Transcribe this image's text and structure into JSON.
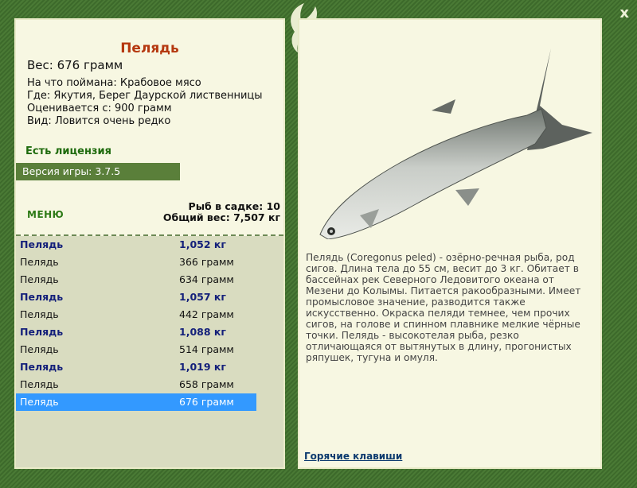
{
  "window": {
    "close_label": "x"
  },
  "catch": {
    "title": "Пелядь",
    "weight": "Вес: 676 грамм",
    "bait": "На что поймана: Крабовое мясо",
    "place": "Где: Якутия, Берег Даурской лиственницы",
    "value": "Оценивается с: 900 грамм",
    "rarity": "Вид: Ловится очень редко"
  },
  "license": "Есть лицензия",
  "version": "Версия игры: 3.7.5",
  "menu_label": "МЕНЮ",
  "cage": {
    "count": "Рыб в садке: 10",
    "total": "Общий вес: 7,507 кг"
  },
  "fish_list": [
    {
      "name": "Пелядь",
      "weight": "1,052 кг",
      "big": true
    },
    {
      "name": "Пелядь",
      "weight": "366 грамм",
      "big": false
    },
    {
      "name": "Пелядь",
      "weight": "634 грамм",
      "big": false
    },
    {
      "name": "Пелядь",
      "weight": "1,057 кг",
      "big": true
    },
    {
      "name": "Пелядь",
      "weight": "442 грамм",
      "big": false
    },
    {
      "name": "Пелядь",
      "weight": "1,088 кг",
      "big": true
    },
    {
      "name": "Пелядь",
      "weight": "514 грамм",
      "big": false
    },
    {
      "name": "Пелядь",
      "weight": "1,019 кг",
      "big": true
    },
    {
      "name": "Пелядь",
      "weight": "658 грамм",
      "big": false
    },
    {
      "name": "Пелядь",
      "weight": "676 грамм",
      "big": false,
      "selected": true
    }
  ],
  "description": "Пелядь (Coregonus peled) - озёрно-речная рыба, род сигов. Длина тела до 55 см, весит до 3 кг. Обитает в бассейнах рек Северного Ледовитого океана от Мезени до Колымы. Питается ракообразными. Имеет промысловое значение, разводится также искусственно. Окраска пеляди темнее, чем прочих сигов, на голове и спинном плавнике мелкие чёрные точки. Пелядь - высокотелая рыба, резко отличающаяся от вытянутых в длину, прогонистых ряпушек, тугуна и омуля.",
  "hotkeys_label": "Горячие клавиши",
  "colors": {
    "frame": "#3f6a2e",
    "panel": "#f7f7e2",
    "list_bg": "#d9dcc0",
    "selected": "#3399ff",
    "title": "#b5380f"
  }
}
